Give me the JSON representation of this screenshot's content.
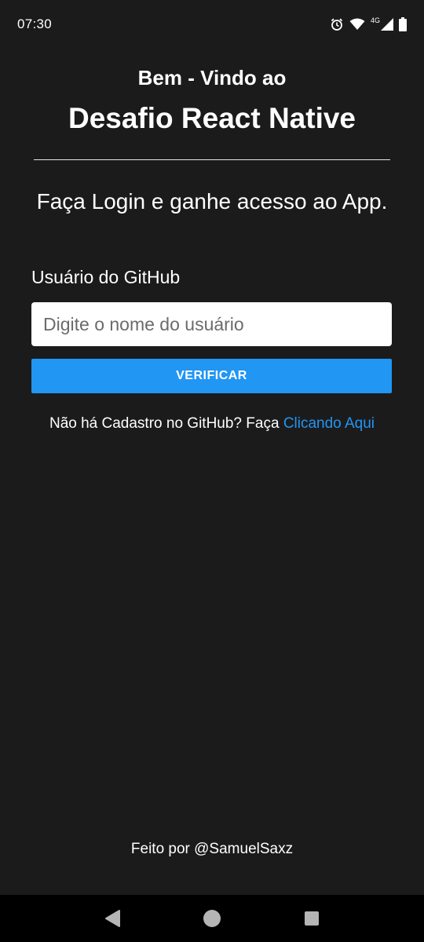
{
  "status_bar": {
    "time": "07:30",
    "network": "4G",
    "icons": [
      "alarm-icon",
      "wifi-icon",
      "signal-icon",
      "battery-icon"
    ]
  },
  "header": {
    "welcome": "Bem - Vindo ao",
    "title": "Desafio React Native",
    "subtitle": "Faça Login e ganhe acesso ao App."
  },
  "form": {
    "label": "Usuário do GitHub",
    "input_value": "",
    "input_placeholder": "Digite o nome do usuário",
    "button_label": "VERIFICAR"
  },
  "signup": {
    "text": "Não há Cadastro no GitHub? Faça ",
    "link_label": "Clicando Aqui"
  },
  "footer": {
    "text": "Feito por @SamuelSaxz"
  },
  "nav_bar": {
    "buttons": [
      "back-icon",
      "home-icon",
      "recents-icon"
    ]
  },
  "colors": {
    "background": "#1c1b1c",
    "accent": "#2196f3",
    "text": "#ffffff",
    "nav_background": "#000000"
  }
}
